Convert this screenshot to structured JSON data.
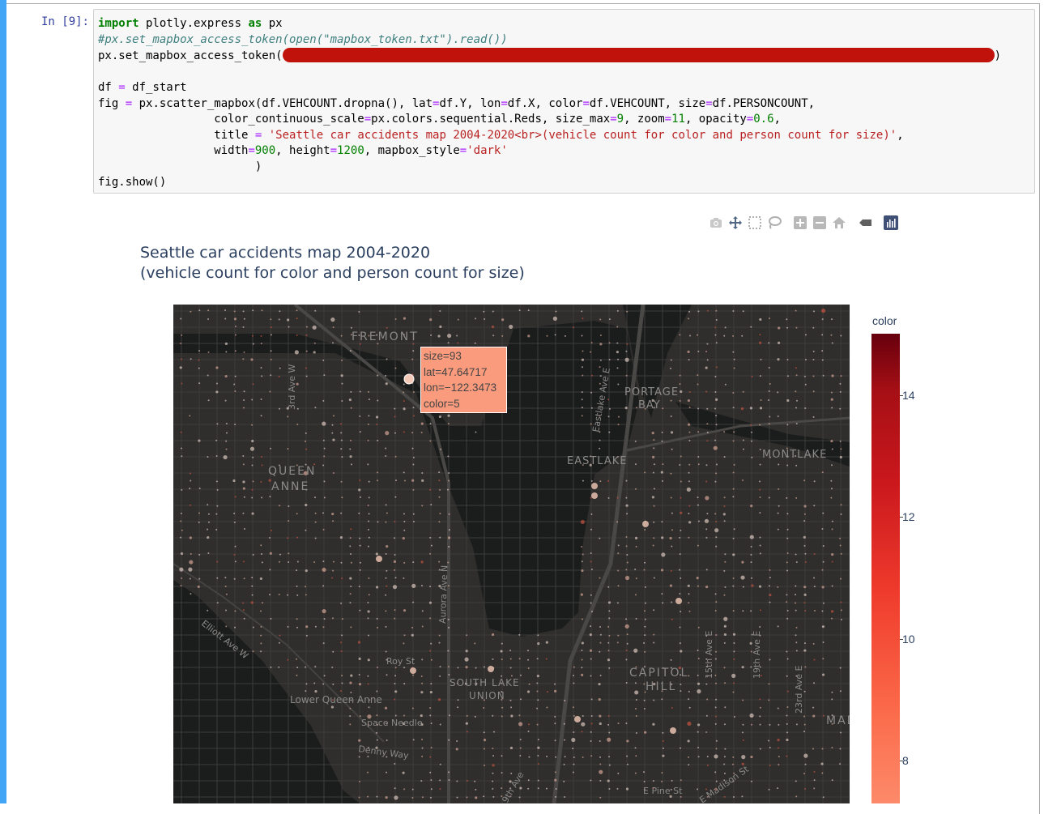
{
  "cell": {
    "prompt": "In [9]:",
    "code_lines": [
      "import plotly.express as px",
      "#px.set_mapbox_access_token(open(\"mapbox_token.txt\").read())",
      "px.set_mapbox_access_token(",
      "",
      "df = df_start",
      "fig = px.scatter_mapbox(df.VEHCOUNT.dropna(), lat=df.Y, lon=df.X, color=df.VEHCOUNT, size=df.PERSONCOUNT,",
      "                 color_continuous_scale=px.colors.sequential.Reds, size_max=9, zoom=11, opacity=0.6,",
      "                 title = 'Seattle car accidents map 2004-2020<br>(vehicle count for color and person count for size)',",
      "                 width=900, height=1200, mapbox_style='dark'",
      "                       )",
      "fig.show()"
    ]
  },
  "modebar": {
    "buttons": [
      "camera-icon",
      "pan-icon",
      "box-select-icon",
      "lasso-icon",
      "zoom-in-icon",
      "zoom-out-icon",
      "home-icon",
      "reset-view-icon",
      "plotly-logo-icon"
    ]
  },
  "figure": {
    "title_line1": "Seattle car accidents map 2004-2020",
    "title_line2": "(vehicle count for color and person count for size)"
  },
  "map": {
    "style": "dark",
    "labels": {
      "fremont": "FREMONT",
      "portage_bay_1": "PORTAGE",
      "portage_bay_2": "BAY",
      "queen_anne_1": "QUEEN",
      "queen_anne_2": "ANNE",
      "eastlake": "EASTLAKE",
      "montlake": "MONTLAKE",
      "capitol_hill_1": "CAPITOL",
      "capitol_hill_2": "HILL",
      "south_lake_union_1": "SOUTH LAKE",
      "south_lake_union_2": "UNION",
      "lower_queen_anne": "Lower Queen Anne",
      "space_needle": "Space Needle",
      "denny_way": "Denny Way",
      "roy_st": "Roy St",
      "third_ave_w": "3rd Ave W",
      "eastlake_ave_e": "Eastlake Ave E",
      "aurora_ave_n": "Aurora Ave N",
      "elliott_ave_w": "Elliott Ave W",
      "fifteenth_ave_e": "15th Ave E",
      "nineteenth_ave_e": "19th Ave E",
      "twentythird_ave_e": "23rd Ave E",
      "e_pine_st": "E Pine St",
      "e_madison_st": "E Madison St",
      "ninth_ave": "9th Ave",
      "madison_valley": "MAD VA"
    },
    "hover": {
      "size": "size=93",
      "lat": "lat=47.64717",
      "lon": "lon=−122.3473",
      "color": "color=5"
    }
  },
  "colorbar": {
    "title": "color",
    "ticks": [
      "14",
      "12",
      "10",
      "8"
    ],
    "tick_values": [
      14,
      12,
      10,
      8
    ],
    "scale": "Reds"
  }
}
